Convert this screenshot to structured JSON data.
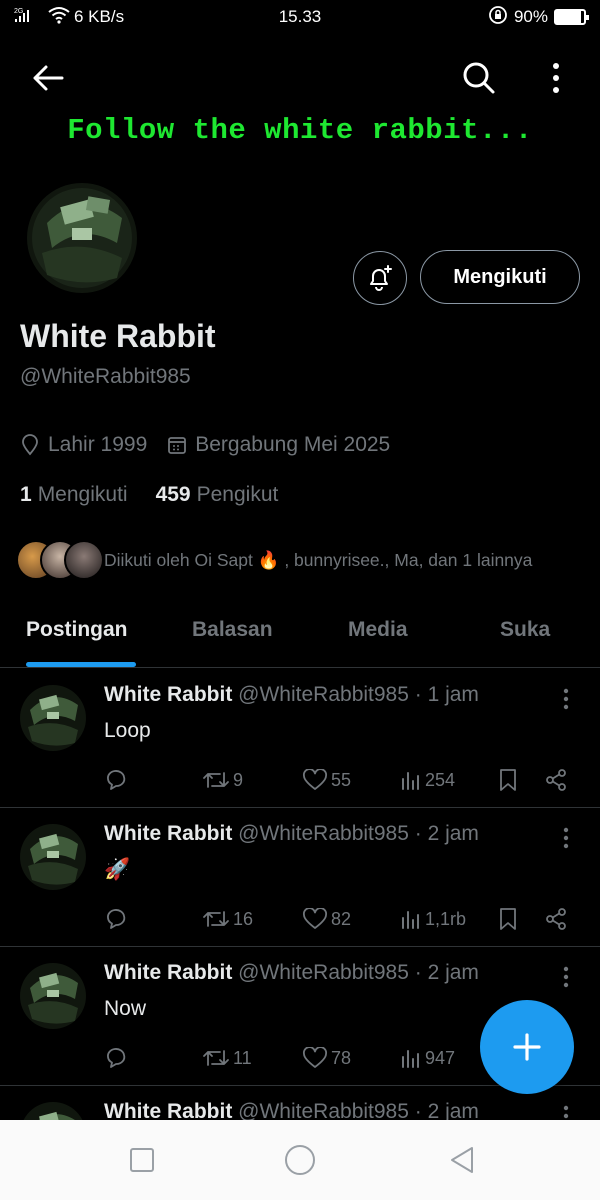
{
  "status_bar": {
    "network": "2G",
    "speed": "6 KB/s",
    "time": "15.33",
    "battery_percent": "90%",
    "battery_level": 0.9
  },
  "banner": {
    "text": "Follow the white rabbit...",
    "text_color": "#1ee831"
  },
  "profile": {
    "display_name": "White Rabbit",
    "handle": "@WhiteRabbit985",
    "following_button": "Mengikuti",
    "birth": "Lahir 1999",
    "joined": "Bergabung Mei 2025",
    "following_count": "1",
    "following_label": "Mengikuti",
    "followers_count": "459",
    "followers_label": "Pengikut",
    "followed_by": "Diikuti oleh Oi Sapt 🔥 , bunnyrisee., Ma, dan 1 lainnya"
  },
  "tabs": [
    {
      "label": "Postingan",
      "active": true
    },
    {
      "label": "Balasan",
      "active": false
    },
    {
      "label": "Media",
      "active": false
    },
    {
      "label": "Suka",
      "active": false
    }
  ],
  "posts": [
    {
      "name": "White Rabbit",
      "handle": "@WhiteRabbit985 · 1 jam",
      "text": "Loop",
      "retweets": "9",
      "likes": "55",
      "views": "254"
    },
    {
      "name": "White Rabbit",
      "handle": "@WhiteRabbit985 · 2 jam",
      "text": "🚀",
      "retweets": "16",
      "likes": "82",
      "views": "1,1rb"
    },
    {
      "name": "White Rabbit",
      "handle": "@WhiteRabbit985 · 2 jam",
      "text": "Now",
      "retweets": "11",
      "likes": "78",
      "views": "947"
    },
    {
      "name": "White Rabbit",
      "handle": "@WhiteRabbit985 · 2 jam",
      "text": "",
      "retweets": "",
      "likes": "",
      "views": ""
    }
  ],
  "colors": {
    "accent": "#1d9bf0",
    "background": "#000000",
    "muted_text": "#71767b",
    "primary_text": "#e7e9ea"
  },
  "icons": {
    "back": "arrow-left-icon",
    "search": "search-icon",
    "more": "more-vertical-icon",
    "bell": "bell-plus-icon",
    "location": "location-pin-icon",
    "calendar": "calendar-icon",
    "reply": "reply-icon",
    "retweet": "retweet-icon",
    "like": "heart-icon",
    "views": "views-icon",
    "bookmark": "bookmark-icon",
    "share": "share-icon",
    "compose": "plus-icon"
  }
}
